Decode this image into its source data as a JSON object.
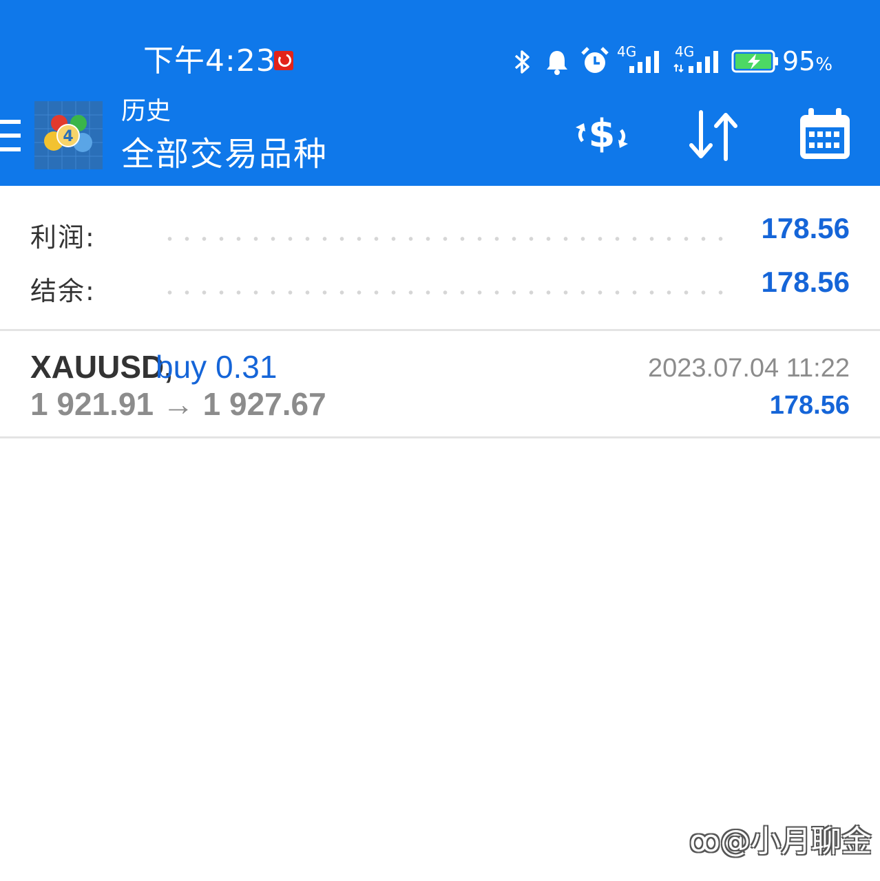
{
  "status_bar": {
    "time": "下午4:23",
    "network_1": "4G",
    "network_2": "4G",
    "battery_percent": "95",
    "percent_sign": "%"
  },
  "toolbar": {
    "title_small": "历史",
    "title_large": "全部交易品种"
  },
  "summary": {
    "profit_label": "利润:",
    "profit_value": "178.56",
    "balance_label": "结余:",
    "balance_value": "178.56"
  },
  "trades": [
    {
      "symbol": "XAUUSD,",
      "side": "buy 0.31",
      "prices": "1 921.91 → 1 927.67",
      "time": "2023.07.04 11:22",
      "profit": "178.56"
    }
  ],
  "watermark": "@小月聊金",
  "colors": {
    "header": "#0f78ea",
    "accent": "#1565d8",
    "muted": "#8c8c8c"
  }
}
